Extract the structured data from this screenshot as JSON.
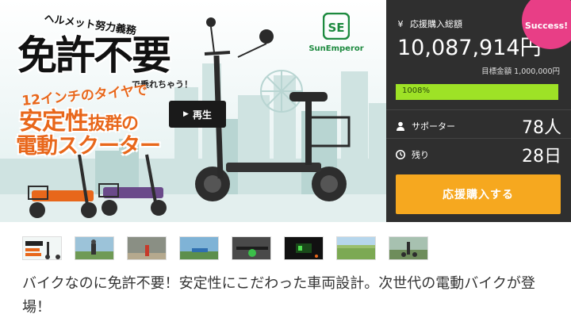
{
  "hero": {
    "helmet_text": "ヘルメット努力義務",
    "headline": "免許不要",
    "riding_text": "で乗れちゃう！",
    "tire_text": "12インチのタイヤで",
    "stability_text": "安定性",
    "stability_suffix": "抜群の",
    "scooter_text": "電動スクーター",
    "brand": "SunEmperor",
    "play_label": "再生"
  },
  "panel": {
    "total_label": "応援購入総額",
    "total_value": "10,087,914円",
    "goal_text": "目標金額 1,000,000円",
    "progress_label": "1008%",
    "progress_fraction": 1.0,
    "supporters_label": "サポーター",
    "supporters_value": "78人",
    "remaining_label": "残り",
    "remaining_value": "28日",
    "buy_label": "応援購入する",
    "badge": "Success!"
  },
  "thumbnails": [
    {
      "icon": "hero-banner-thumb"
    },
    {
      "icon": "rider-street-thumb"
    },
    {
      "icon": "scooter-park-thumb"
    },
    {
      "icon": "blue-scooter-thumb"
    },
    {
      "icon": "handlebar-closeup-thumb"
    },
    {
      "icon": "dashboard-display-thumb"
    },
    {
      "icon": "riverside-thumb"
    },
    {
      "icon": "scooter-grass-thumb"
    }
  ],
  "description": "バイクなのに免許不要！安定性にこだわった車両設計。次世代の電動バイクが登場！",
  "colors": {
    "accent": "#f6a81f",
    "progress": "#9ee226",
    "badge": "#e83e86",
    "panel": "#2f2f2f",
    "brand": "#e8671b"
  }
}
